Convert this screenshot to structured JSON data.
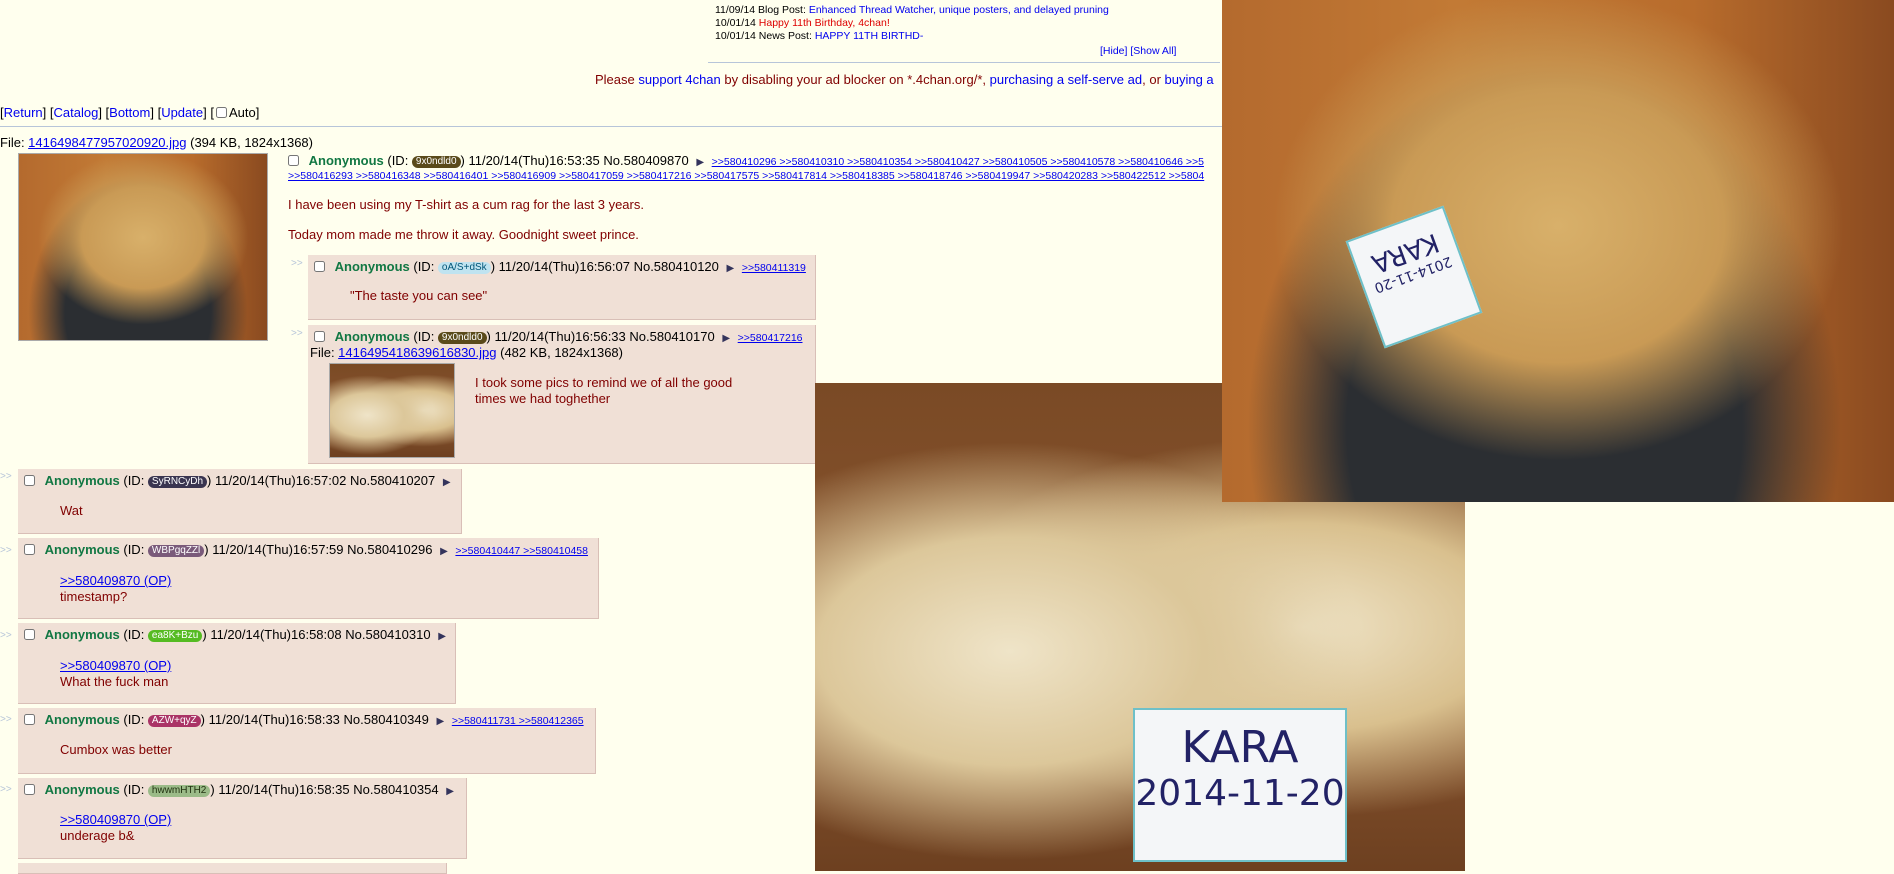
{
  "news": [
    {
      "date": "11/09/14",
      "prefix": "Blog Post:",
      "text": "Enhanced Thread Watcher, unique posters, and delayed pruning",
      "color": "blue"
    },
    {
      "date": "10/01/14",
      "prefix": "",
      "text": "Happy 11th Birthday, 4chan!",
      "color": "red"
    },
    {
      "date": "10/01/14",
      "prefix": "News Post:",
      "text": "HAPPY 11TH BIRTHD-",
      "color": "blue"
    }
  ],
  "news_controls": {
    "hide": "[Hide]",
    "show_all": "[Show All]"
  },
  "adline": {
    "t1": "Please ",
    "l1": "support 4chan",
    "t2": " by disabling your ad blocker on *.4chan.org/*, ",
    "l2": "purchasing a self-serve ad",
    "t3": ", or ",
    "l3": "buying a"
  },
  "nav": {
    "return": "Return",
    "catalog": "Catalog",
    "bottom": "Bottom",
    "update": "Update",
    "auto": "Auto"
  },
  "op": {
    "file_label": "File: ",
    "file_name": "1416498477957020920.jpg",
    "file_meta": " (394 KB, 1824x1368)",
    "name": "Anonymous",
    "id": "9x0ndld0",
    "datetime": "11/20/14(Thu)16:53:35",
    "no": "No.580409870",
    "backlinks_1": ">>580410296 >>580410310 >>580410354 >>580410427 >>580410505 >>580410578 >>580410646 >>5",
    "backlinks_2": ">>580416293 >>580416348 >>580416401 >>580416909 >>580417059 >>580417216 >>580417575 >>580417814 >>580418385 >>580418746 >>580419947 >>580420283 >>580422512 >>5804",
    "line1": "I have been using my T-shirt as a cum rag for the last 3 years.",
    "line2": "Today mom made me throw it away. Goodnight sweet prince."
  },
  "replies": [
    {
      "name": "Anonymous",
      "id": "oA/S+dSk",
      "datetime": "11/20/14(Thu)16:56:07",
      "no": "No.580410120",
      "backlinks": ">>580411319",
      "quote": "",
      "text": "\"The taste you can see\""
    },
    {
      "name": "Anonymous",
      "id": "9x0ndld0",
      "datetime": "11/20/14(Thu)16:56:33",
      "no": "No.580410170",
      "backlinks": ">>580417216",
      "file_label": "File: ",
      "file_name": "1416495418639616830.jpg",
      "file_meta": " (482 KB, 1824x1368)",
      "quote": "",
      "text": "I took some pics to remind we of all the good times we had toghether"
    },
    {
      "name": "Anonymous",
      "id": "SyRNCyDh",
      "datetime": "11/20/14(Thu)16:57:02",
      "no": "No.580410207",
      "backlinks": "",
      "quote": "",
      "text": "Wat"
    },
    {
      "name": "Anonymous",
      "id": "WBPgqZZl",
      "datetime": "11/20/14(Thu)16:57:59",
      "no": "No.580410296",
      "backlinks": ">>580410447 >>580410458",
      "quote": ">>580409870 (OP)",
      "text": "timestamp?"
    },
    {
      "name": "Anonymous",
      "id": "ea8K+Bzu",
      "datetime": "11/20/14(Thu)16:58:08",
      "no": "No.580410310",
      "backlinks": "",
      "quote": ">>580409870 (OP)",
      "text": "What the fuck man"
    },
    {
      "name": "Anonymous",
      "id": "AZW+qyZ",
      "datetime": "11/20/14(Thu)16:58:33",
      "no": "No.580410349",
      "backlinks": ">>580411731 >>580412365",
      "quote": "",
      "text": "Cumbox was better"
    },
    {
      "name": "Anonymous",
      "id": "hwwmHTH2",
      "datetime": "11/20/14(Thu)16:58:35",
      "no": "No.580410354",
      "backlinks": "",
      "quote": ">>580409870 (OP)",
      "text": "underage b&"
    }
  ],
  "id_colors": {
    "9x0ndld0": "#5a4a1a",
    "oA/S+dSk": "#bfe3f0",
    "SyRNCyDh": "#3a3550",
    "WBPgqZZl": "#7a5a7a",
    "ea8K+Bzu": "#55bb22",
    "AZW+qyZ": "#aa3366",
    "hwwmHTH2": "#9bbb88"
  },
  "card_text": {
    "top": "KARA",
    "bottom": "2014-11-20"
  },
  "arrow": "▶",
  "quote_mark": ">>"
}
